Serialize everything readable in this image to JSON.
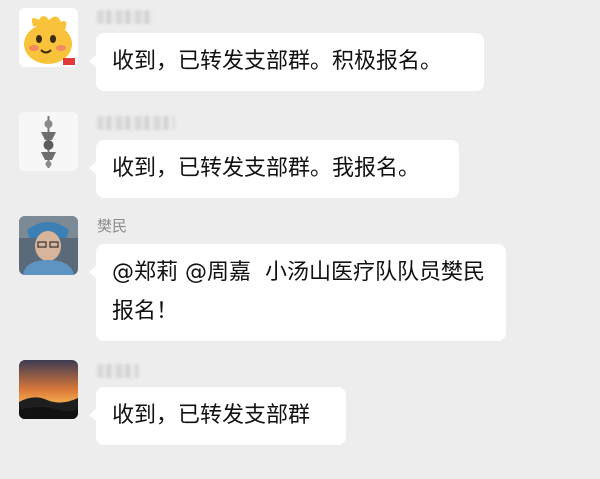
{
  "messages": [
    {
      "sender": "",
      "sender_blurred": true,
      "avatar": "cartoon-face-icon",
      "text": "收到，已转发支部群。积极报名。"
    },
    {
      "sender": "",
      "sender_blurred": true,
      "avatar": "ornament-icon",
      "text": "收到，已转发支部群。我报名。"
    },
    {
      "sender": "樊民",
      "sender_blurred": false,
      "avatar": "doctor-photo",
      "text": "@郑莉 @周嘉  小汤山医疗队队员樊民报名！"
    },
    {
      "sender": "",
      "sender_blurred": true,
      "avatar": "sunset-photo",
      "text": "收到，已转发支部群"
    }
  ],
  "colors": {
    "background": "#ededed",
    "bubble": "#ffffff",
    "name_text": "#8c8c8c"
  }
}
